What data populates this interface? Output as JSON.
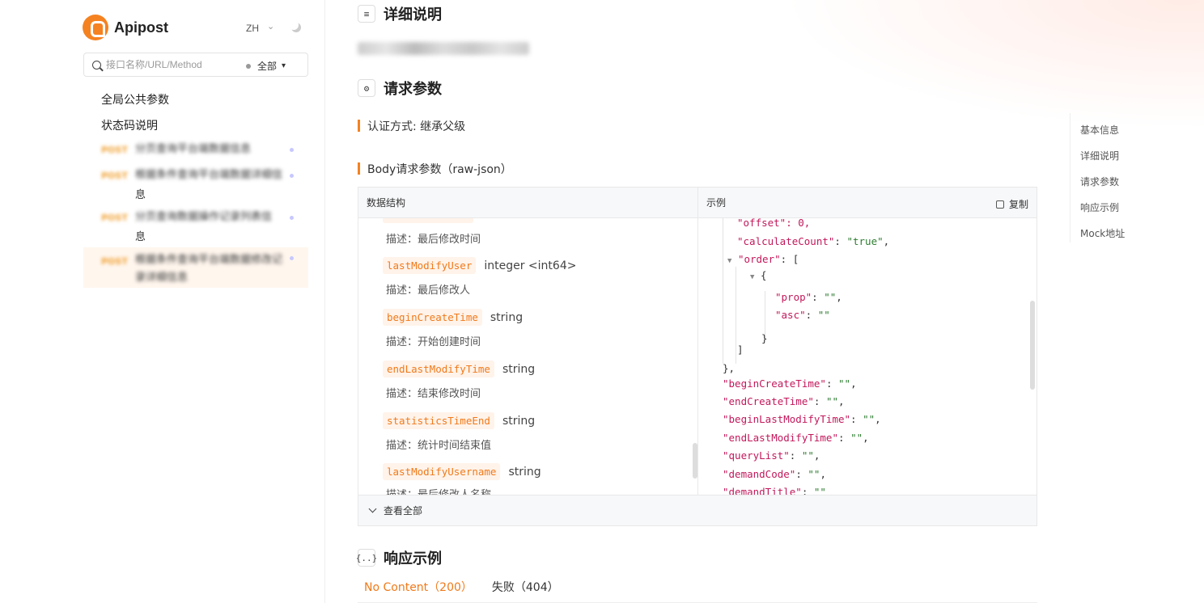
{
  "brand": {
    "name": "Apipost",
    "lang": "ZH"
  },
  "search": {
    "placeholder": "接口名称/URL/Method",
    "filter": "全部"
  },
  "nav": {
    "global_params": "全局公共参数",
    "status_codes": "状态码说明"
  },
  "api_list": [
    {
      "method": "POST",
      "name": "分页查询平台端数据信息",
      "tail": ""
    },
    {
      "method": "POST",
      "name": "根据条件查询平台端数据详细信",
      "tail": "息"
    },
    {
      "method": "POST",
      "name": "分页查询数据操作记录列表信",
      "tail": "息"
    },
    {
      "method": "POST",
      "name": "根据条件查询平台端数据修改记录详细信息",
      "tail": ""
    }
  ],
  "sections": {
    "detail": "详细说明",
    "request": "请求参数",
    "response": "响应示例"
  },
  "auth": "认证方式: 继承父级",
  "body_label": "Body请求参数（raw-json）",
  "table": {
    "left_header": "数据结构",
    "right_header": "示例",
    "copy": "复制",
    "view_all": "查看全部"
  },
  "fields": [
    {
      "desc": "描述：最后修改时间"
    },
    {
      "name": "lastModifyUser",
      "type": "integer <int64>",
      "desc": "描述：最后修改人"
    },
    {
      "name": "beginCreateTime",
      "type": "string",
      "desc": "描述：开始创建时间"
    },
    {
      "name": "endLastModifyTime",
      "type": "string",
      "desc": "描述：结束修改时间"
    },
    {
      "name": "statisticsTimeEnd",
      "type": "string",
      "desc": "描述：统计时间结束值"
    },
    {
      "name": "lastModifyUsername",
      "type": "string",
      "desc": "描述：最后修改人名称"
    }
  ],
  "json_example": {
    "offset": "\"offset\": 0,",
    "calc_key": "\"calculateCount\"",
    "calc_val": "\"true\"",
    "order_key": "\"order\"",
    "prop_key": "\"prop\"",
    "asc_key": "\"asc\"",
    "empty": "\"\"",
    "keys": [
      "\"beginCreateTime\"",
      "\"endCreateTime\"",
      "\"beginLastModifyTime\"",
      "\"endLastModifyTime\"",
      "\"queryList\"",
      "\"demandCode\"",
      "\"demandTitle\""
    ]
  },
  "response_tabs": [
    "No Content（200）",
    "失败（404）"
  ],
  "toc": [
    "基本信息",
    "详细说明",
    "请求参数",
    "响应示例",
    "Mock地址"
  ],
  "colors": {
    "accent": "#f58220",
    "key": "#c2185b",
    "string": "#2e7d32",
    "number": "#1565c0"
  }
}
